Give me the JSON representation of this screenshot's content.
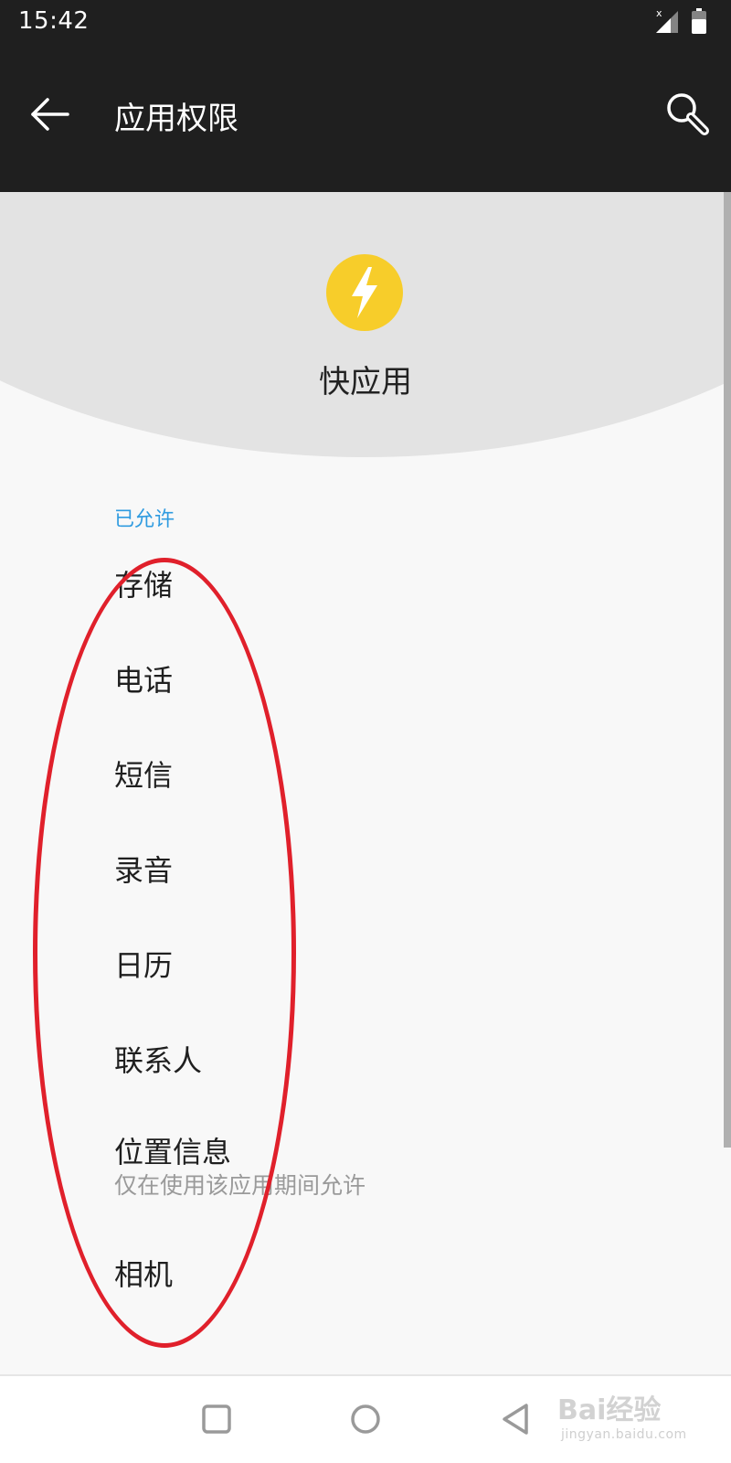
{
  "status_bar": {
    "time": "15:42",
    "icons": [
      "signal-icon",
      "battery-icon"
    ]
  },
  "app_bar": {
    "title": "应用权限",
    "back_icon": "back-arrow-icon",
    "search_icon": "search-icon"
  },
  "app": {
    "name": "快应用",
    "icon": "lightning-bolt-icon",
    "icon_color": "#f7cd2a"
  },
  "permissions": {
    "section_label": "已允许",
    "items": [
      {
        "label": "存储"
      },
      {
        "label": "电话"
      },
      {
        "label": "短信"
      },
      {
        "label": "录音"
      },
      {
        "label": "日历"
      },
      {
        "label": "联系人"
      },
      {
        "label": "位置信息",
        "sub": "仅在使用该应用期间允许"
      },
      {
        "label": "相机"
      }
    ]
  },
  "nav_bar": {
    "buttons": [
      "recent-apps-icon",
      "home-icon",
      "back-triangle-icon"
    ]
  },
  "watermark": {
    "main": "Bai经验",
    "sub": "jingyan.baidu.com"
  },
  "colors": {
    "accent": "#2f9be0",
    "annotation": "#e0202b",
    "bar_background": "#1f1f1f"
  }
}
